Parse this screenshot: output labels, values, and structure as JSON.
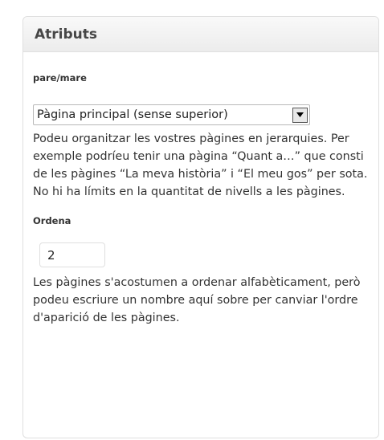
{
  "box": {
    "title": "Atributs"
  },
  "parent": {
    "label": "pare/mare",
    "selected": "Pàgina principal (sense superior)",
    "help": "Podeu organitzar les vostres pàgines en jerarquies. Per exemple podríeu tenir una pàgina “Quant a…” que consti de les pàgines “La meva història” i “El meu gos” per sota. No hi ha límits en la quantitat de nivells a les pàgines.",
    "arrow_icon": "chevron-down-icon"
  },
  "order": {
    "label": "Ordena",
    "value": "2",
    "help": "Les pàgines s'acostumen a ordenar alfabèticament, però podeu escriure un nombre aquí sobre per canviar l'ordre d'aparició de les pàgines."
  },
  "colors": {
    "header_bg": "#ececec",
    "border": "#dfdfdf",
    "text": "#333333"
  }
}
